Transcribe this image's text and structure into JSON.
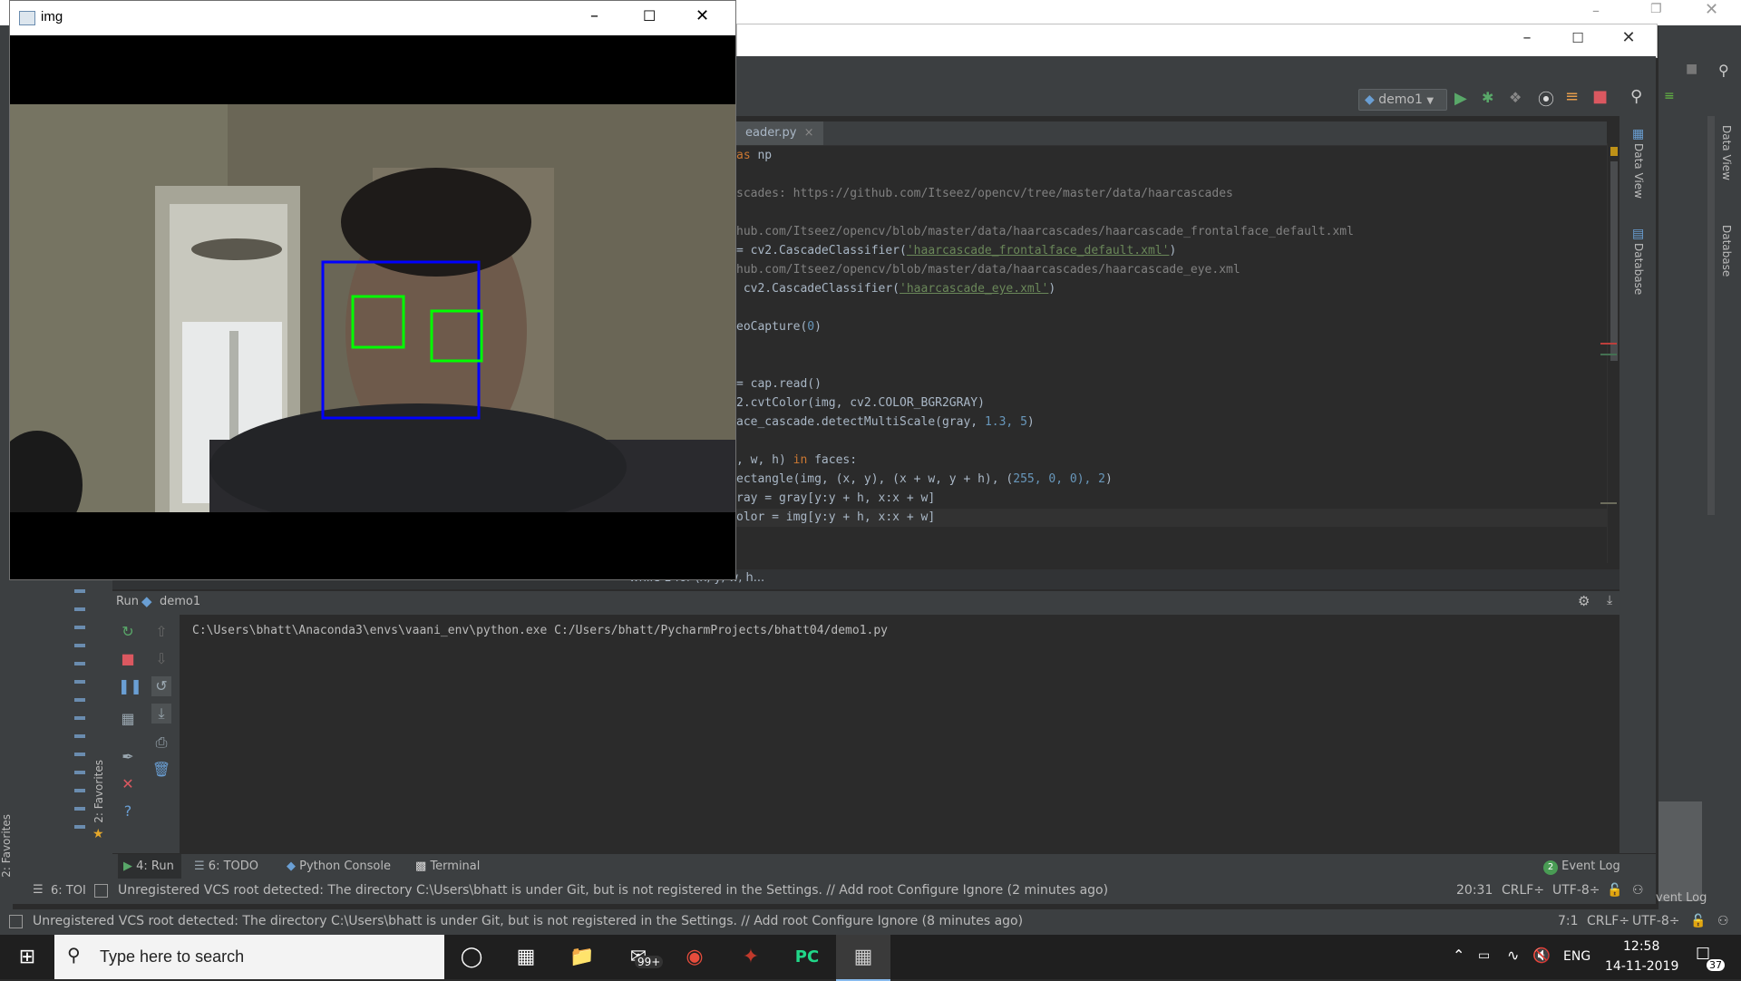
{
  "img_window": {
    "title": "img"
  },
  "ide": {
    "run_config": "demo1",
    "tab_label": "eader.py",
    "tab_close": "×",
    "code_lines": [
      {
        "pre": "",
        "kw": "as",
        "post": " np",
        "comment": "",
        "str": ""
      },
      {
        "pre": "",
        "kw": "",
        "post": "",
        "comment": "",
        "str": ""
      },
      {
        "pre": "",
        "kw": "",
        "post": "",
        "comment": "scades: https://github.com/Itseez/opencv/tree/master/data/haarcascades",
        "str": ""
      },
      {
        "pre": "",
        "kw": "",
        "post": "",
        "comment": "",
        "str": ""
      },
      {
        "pre": "",
        "kw": "",
        "post": "",
        "comment": "hub.com/Itseez/opencv/blob/master/data/haarcascades/haarcascade_frontalface_default.xml",
        "str": ""
      },
      {
        "pre": "= cv2.CascadeClassifier(",
        "kw": "",
        "post": ")",
        "comment": "",
        "str": "'haarcascade_frontalface_default.xml'"
      },
      {
        "pre": "",
        "kw": "",
        "post": "",
        "comment": "hub.com/Itseez/opencv/blob/master/data/haarcascades/haarcascade_eye.xml",
        "str": ""
      },
      {
        "pre": " cv2.CascadeClassifier(",
        "kw": "",
        "post": ")",
        "comment": "",
        "str": "'haarcascade_eye.xml'"
      },
      {
        "pre": "",
        "kw": "",
        "post": "",
        "comment": "",
        "str": ""
      },
      {
        "pre": "eoCapture(",
        "kw": "",
        "post": ")",
        "comment": "",
        "str": "",
        "num": "0"
      },
      {
        "pre": "",
        "kw": "",
        "post": "",
        "comment": "",
        "str": ""
      },
      {
        "pre": "",
        "kw": "",
        "post": "",
        "comment": "",
        "str": ""
      },
      {
        "pre": "= cap.read()",
        "kw": "",
        "post": "",
        "comment": "",
        "str": ""
      },
      {
        "pre": "2.cvtColor(img, cv2.COLOR_BGR2GRAY)",
        "kw": "",
        "post": "",
        "comment": "",
        "str": ""
      },
      {
        "pre": "ace_cascade.detectMultiScale(gray, ",
        "kw": "",
        "post": ")",
        "comment": "",
        "str": "",
        "num": "1.3, 5"
      },
      {
        "pre": "",
        "kw": "",
        "post": "",
        "comment": "",
        "str": ""
      },
      {
        "pre": ", w, h) ",
        "kw": "in",
        "post": " faces:",
        "comment": "",
        "str": ""
      },
      {
        "pre": "ectangle(img, (x, y), (x + w, y + h), (",
        "kw": "",
        "post": ")",
        "comment": "",
        "str": "",
        "num": "255, 0, 0), 2"
      },
      {
        "pre": "ray = gray[y:y + h, x:x + w]",
        "kw": "",
        "post": "",
        "comment": "",
        "str": ""
      },
      {
        "pre": "olor = img[y:y + h, x:x + w]",
        "kw": "",
        "post": "",
        "comment": "",
        "str": ""
      }
    ],
    "breadcrumb": "while 1   for (x, y, w, h...",
    "run_label": "Run",
    "run_config_name": "demo1",
    "console_output": "C:\\Users\\bhatt\\Anaconda3\\envs\\vaani_env\\python.exe C:/Users/bhatt/PycharmProjects/bhatt04/demo1.py",
    "right_tools": [
      "Data View",
      "Database"
    ],
    "favorites_label": "2: Favorites",
    "bottom_tabs": {
      "run": "4: Run",
      "todo": "6: TODO",
      "python_console": "Python Console",
      "terminal": "Terminal",
      "event_log": "Event Log",
      "event_count": "2"
    },
    "status_bar_front": {
      "message": "Unregistered VCS root detected: The directory C:\\Users\\bhatt is under Git, but is not registered in the Settings. // Add root  Configure  Ignore (2 minutes ago)",
      "position": "20:31",
      "line_sep": "CRLF÷",
      "encoding": "UTF-8÷"
    },
    "status_bar_back": {
      "message": "Unregistered VCS root detected: The directory C:\\Users\\bhatt is under Git, but is not registered in the Settings. // Add root  Configure  Ignore (8 minutes ago)",
      "position": "7:1",
      "line_sep": "CRLF÷",
      "encoding": "UTF-8÷",
      "todo_fragment": "6: TOI",
      "event_fragment": "vent Log",
      "favorites_label": "2: Favorites"
    }
  },
  "taskbar": {
    "search_placeholder": "Type here to search",
    "mail_badge": "99+",
    "language": "ENG",
    "time": "12:58",
    "date": "14-11-2019",
    "notification_count": "37"
  },
  "colors": {
    "face_box": "#0000ff",
    "eye_box": "#00ff00",
    "ide_bg": "#2b2b2b",
    "ide_panel": "#3c3f41"
  }
}
